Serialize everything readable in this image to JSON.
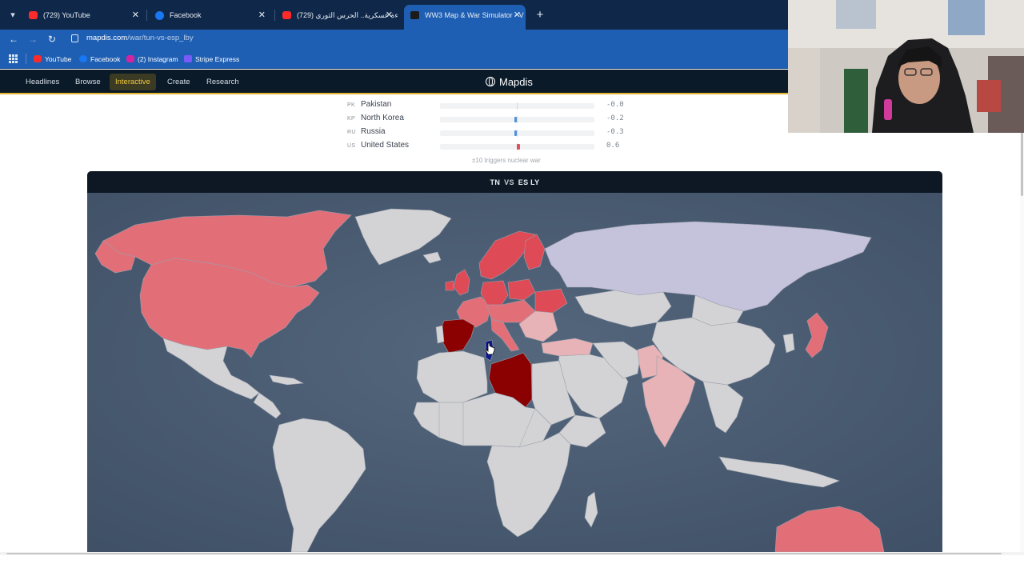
{
  "browser": {
    "tabs": [
      {
        "title": "(729) YouTube",
        "favicon": "youtube-icon",
        "active": false
      },
      {
        "title": "Facebook",
        "favicon": "facebook-icon",
        "active": false
      },
      {
        "title": "(729) قراءة عسكرية.. الحرس الثوري",
        "favicon": "youtube-icon",
        "active": false
      },
      {
        "title": "WW3 Map & War Simulator - V",
        "favicon": "mapdis-icon",
        "active": true
      }
    ],
    "url": {
      "host": "mapdis.com",
      "path": "/war/tun-vs-esp_lby"
    },
    "bookmarks": [
      {
        "label": "YouTube",
        "favicon": "youtube-icon"
      },
      {
        "label": "Facebook",
        "favicon": "facebook-icon"
      },
      {
        "label": "(2) Instagram",
        "favicon": "instagram-icon"
      },
      {
        "label": "Stripe Express",
        "favicon": "stripe-icon"
      }
    ]
  },
  "site": {
    "brand": "Mapdis",
    "nav": [
      {
        "label": "Headlines",
        "active": false
      },
      {
        "label": "Browse",
        "active": false
      },
      {
        "label": "Interactive",
        "active": true
      },
      {
        "label": "Create",
        "active": false
      },
      {
        "label": "Research",
        "active": false
      }
    ],
    "accent_color": "#e2b32c"
  },
  "tension": {
    "rows": [
      {
        "code": "PK",
        "name": "Pakistan",
        "value": "-0.0",
        "color": "#d7d9dd"
      },
      {
        "code": "KP",
        "name": "North Korea",
        "value": "-0.2",
        "color": "#4f8fdc"
      },
      {
        "code": "RU",
        "name": "Russia",
        "value": "-0.3",
        "color": "#4f8fdc"
      },
      {
        "code": "US",
        "name": "United States",
        "value": "0.6",
        "color": "#e0505c"
      }
    ],
    "note": "±10 triggers nuclear war"
  },
  "map": {
    "header": {
      "side_a": "TN",
      "vs": "VS",
      "side_b": "ES LY"
    },
    "colors": {
      "ocean": "#4b5d73",
      "neutral": "#d3d3d5",
      "ally_light": "#e26f78",
      "ally_mid": "#de4b57",
      "enemy_primary": "#8b0000",
      "attacker": "#0e1a8c",
      "russia_bloc": "#c5c2dc",
      "partial": "#e8b3b6"
    }
  }
}
